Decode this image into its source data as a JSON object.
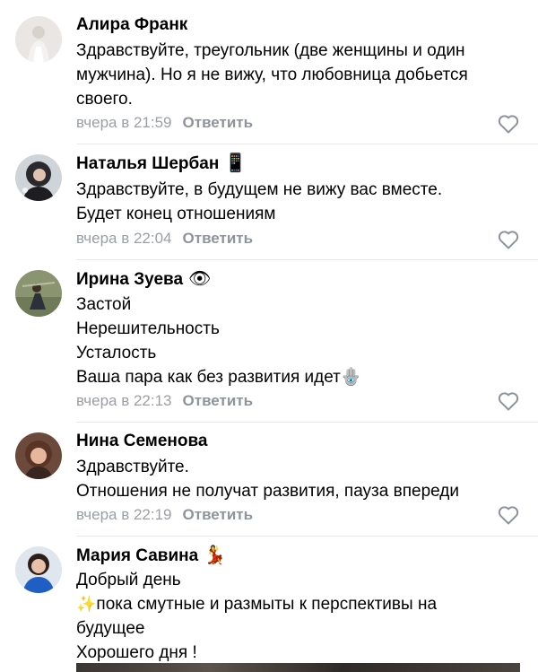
{
  "comments": [
    {
      "author": "Алира Франк",
      "emoji": "",
      "lines": [
        "Здравствуйте, треугольник (две женщины и один",
        "мужчина). Но я не вижу, что любовница добьется",
        "своего."
      ],
      "time": "вчера в 21:59",
      "reply": "Ответить"
    },
    {
      "author": "Наталья Шербан",
      "emoji": "📱",
      "lines": [
        "Здравствуйте, в будущем не вижу вас вместе.",
        "Будет конец отношениям"
      ],
      "time": "вчера в 22:04",
      "reply": "Ответить"
    },
    {
      "author": "Ирина Зуева",
      "emoji": "👁",
      "lines": [
        "Застой",
        "Нерешительность",
        "Усталость",
        "Ваша пара как без развития идет"
      ],
      "line_emoji": "🪬",
      "time": "вчера в 22:13",
      "reply": "Ответить"
    },
    {
      "author": "Нина Семенова",
      "emoji": "",
      "lines": [
        "Здравствуйте.",
        "Отношения не получат развития, пауза впереди"
      ],
      "time": "вчера в 22:19",
      "reply": "Ответить"
    },
    {
      "author": "Мария Савина",
      "emoji": "💃",
      "lines": [
        "Добрый день",
        "пока смутные и размыты к перспективы на",
        "будущее",
        "Хорошего дня !"
      ],
      "line_prefix_emoji": "✨"
    }
  ],
  "icons": {
    "like": "heart-outline-icon"
  },
  "colors": {
    "meta": "#9a9fa6",
    "reply": "#8e949b",
    "heart": "#8e949b"
  }
}
